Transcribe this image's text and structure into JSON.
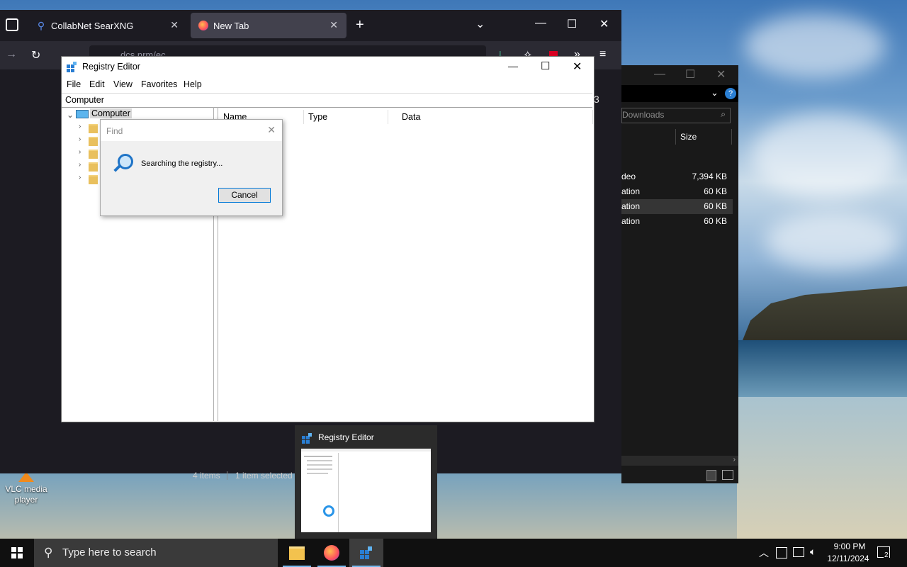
{
  "browser": {
    "tabs": [
      {
        "label": "CollabNet SearXNG",
        "active": false
      },
      {
        "label": "New Tab",
        "active": true
      }
    ],
    "url_partial": "dcs.nrm/ec",
    "accent": "#fbfbfe"
  },
  "explorer": {
    "search_placeholder": "Downloads",
    "column_size": "Size",
    "rows": [
      {
        "type": "deo",
        "size": "7,394 KB"
      },
      {
        "type": "ation",
        "size": "60 KB"
      },
      {
        "type": "ation",
        "size": "60 KB"
      },
      {
        "type": "ation",
        "size": "60 KB"
      }
    ],
    "status_items": "4 items",
    "status_selected": "1 item selected",
    "partial_digit": "3"
  },
  "regedit": {
    "title": "Registry Editor",
    "menu": [
      "File",
      "Edit",
      "View",
      "Favorites",
      "Help"
    ],
    "address": "Computer",
    "tree_root": "Computer",
    "columns": [
      "Name",
      "Type",
      "Data"
    ]
  },
  "find_dialog": {
    "title": "Find",
    "message": "Searching the registry...",
    "cancel_label": "Cancel"
  },
  "thumbnail": {
    "title": "Registry Editor"
  },
  "desktop": {
    "icon_label": "VLC media player"
  },
  "taskbar": {
    "search_placeholder": "Type here to search",
    "time": "9:00 PM",
    "date": "12/11/2024",
    "notification_count": "2"
  }
}
